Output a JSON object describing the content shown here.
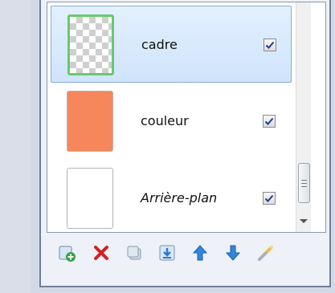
{
  "layers_panel": {
    "layers": [
      {
        "name": "cadre",
        "visible": true,
        "selected": true,
        "thumbnail": "transparent-checker"
      },
      {
        "name": "couleur",
        "visible": true,
        "selected": false,
        "thumbnail": "orange-fill"
      },
      {
        "name": "Arrière-plan",
        "visible": true,
        "selected": false,
        "thumbnail": "white-fill"
      }
    ],
    "toolbar": {
      "icons": [
        "add-layer-icon",
        "delete-layer-icon",
        "duplicate-layer-icon",
        "merge-down-icon",
        "move-up-icon",
        "move-down-icon",
        "layer-properties-icon"
      ]
    },
    "colors": {
      "selection": "#cfe4fb",
      "thumbnail_orange": "#f6875a",
      "thumbnail_selected_border": "#69c96d"
    }
  }
}
